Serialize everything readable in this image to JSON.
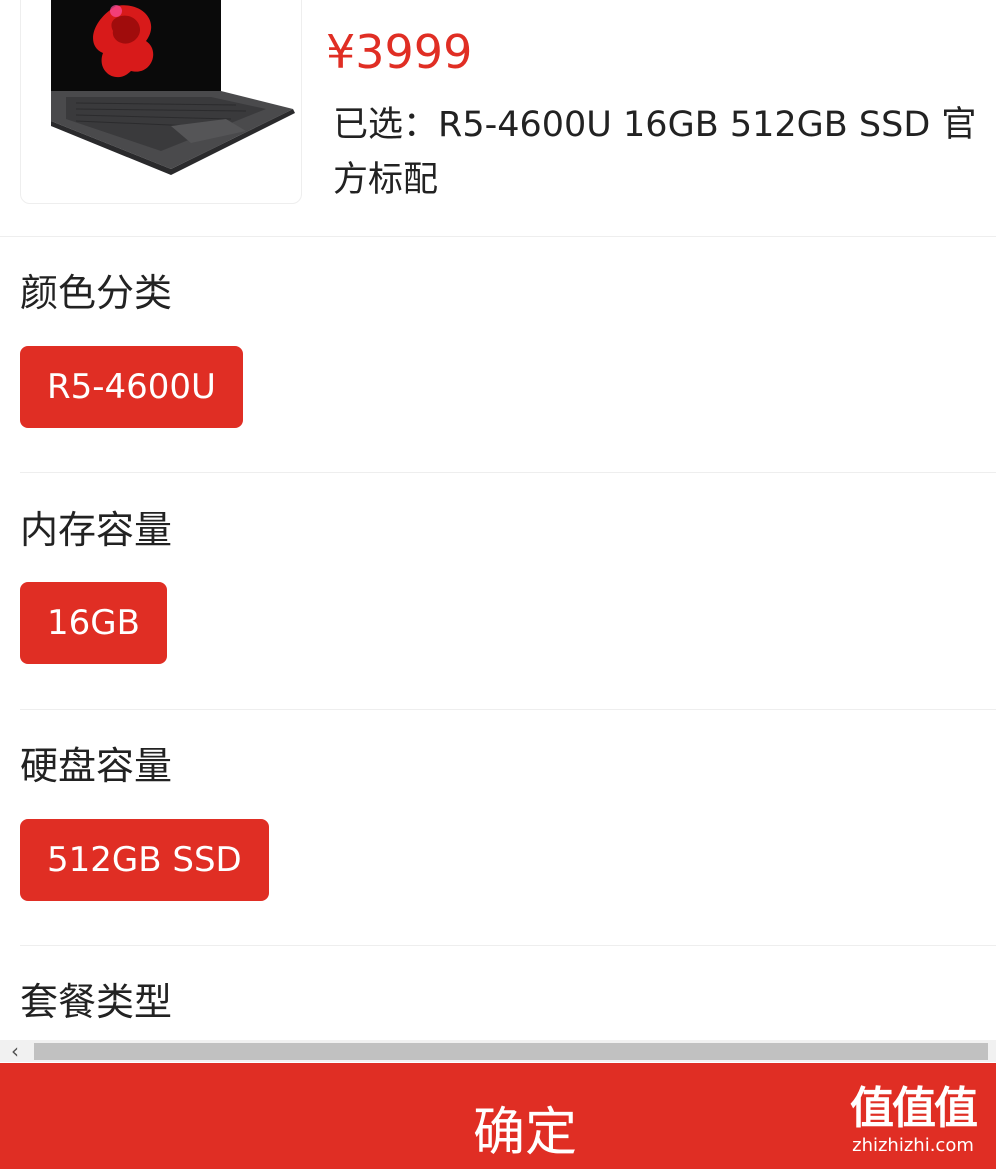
{
  "product": {
    "price": "¥3999",
    "selected_text": "已选：R5-4600U 16GB 512GB SSD 官方标配",
    "image_icon": "laptop-image"
  },
  "sections": [
    {
      "title": "颜色分类",
      "options": [
        {
          "label": "R5-4600U",
          "selected": true
        }
      ]
    },
    {
      "title": "内存容量",
      "options": [
        {
          "label": "16GB",
          "selected": true
        }
      ]
    },
    {
      "title": "硬盘容量",
      "options": [
        {
          "label": "512GB SSD",
          "selected": true
        }
      ]
    },
    {
      "title": "套餐类型",
      "options": []
    }
  ],
  "scrollbar": {
    "left_arrow": "‹"
  },
  "footer": {
    "confirm_label": "确定",
    "watermark_logo": "值值值",
    "watermark_url": "zhizhizhi.com"
  },
  "colors": {
    "accent": "#e02e24",
    "text": "#222222",
    "divider": "#eeeeee"
  }
}
